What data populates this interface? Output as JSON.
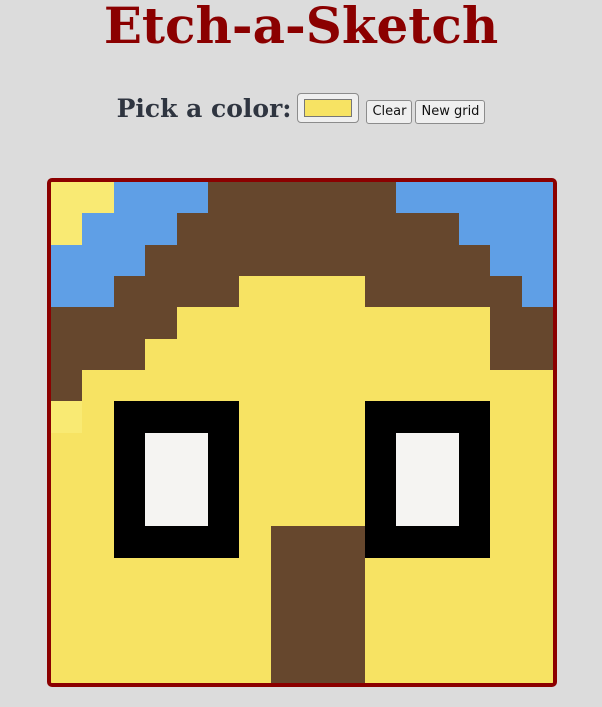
{
  "title": "Etch-a-Sketch",
  "controls": {
    "picker_label": "Pick a color:",
    "selected_color": "#f7e363",
    "clear_label": "Clear",
    "new_grid_label": "New grid"
  },
  "palette": {
    "Y": "#f7e363",
    "y": "#f9ea73",
    "B": "#5f9fe6",
    "N": "#66472d",
    "K": "#000000",
    "W": "#f5f4f2"
  },
  "grid": {
    "size": 16,
    "rows": [
      "yyBBBNNNNNNBBBBB",
      "yBBBNNNNNNNNNBBB",
      "BBBNNNNNNNNNNNBB",
      "BBNNNNYYYYNNNNNB",
      "NNNNYYYYYYYYYYNN",
      "NNNYYYYYYYYYYYNN",
      "NYYYYYYYYYYYYYYY",
      "yYKKKKYYYYKKKKYY",
      "YYKWWKYYYYKWWKYY",
      "YYKWWKYYYYKWWKYY",
      "YYKWWKYYYYKWWKYY",
      "YYKKKKYNNNKKKKYY",
      "YYYYYYYNNNYYYYYY",
      "YYYYYYYNNNYYYYYY",
      "YYYYYYYNNNYYYYYY",
      "YYYYYYYNNNYYYYYY"
    ]
  }
}
